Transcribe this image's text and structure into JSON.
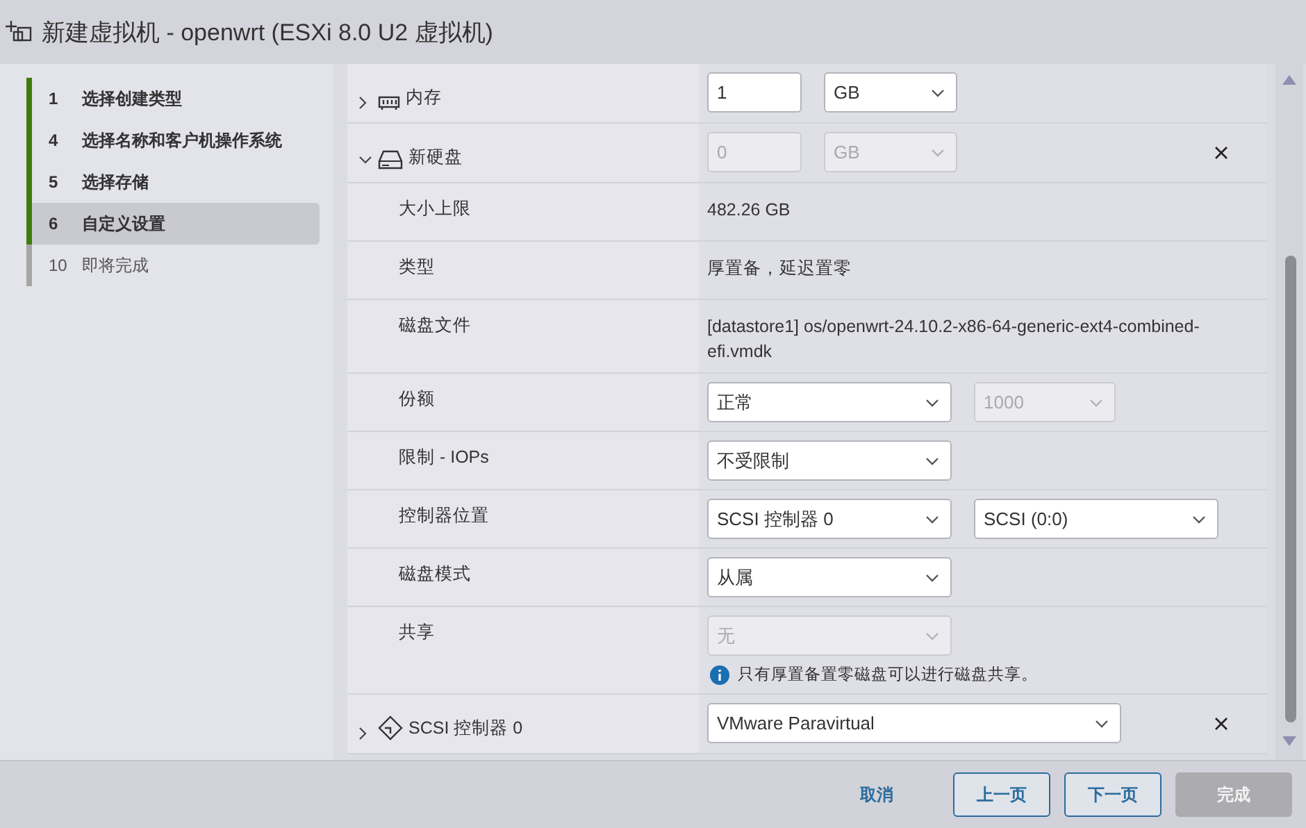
{
  "window": {
    "title": "新建虚拟机 - openwrt (ESXi 8.0 U2 虚拟机)"
  },
  "steps": [
    {
      "number": "1",
      "label": "选择创建类型",
      "completed": true,
      "selected": false
    },
    {
      "number": "4",
      "label": "选择名称和客户机操作系统",
      "completed": true,
      "selected": false
    },
    {
      "number": "5",
      "label": "选择存储",
      "completed": true,
      "selected": false
    },
    {
      "number": "6",
      "label": "自定义设置",
      "completed": true,
      "selected": true
    },
    {
      "number": "10",
      "label": "即将完成",
      "completed": false,
      "selected": false
    }
  ],
  "hardware": [
    {
      "kind": "device",
      "label": "内存",
      "expanded": false,
      "removable": false,
      "controls": [
        {
          "kind": "input",
          "value": "1",
          "disabled": false
        },
        {
          "kind": "select",
          "value": "GB",
          "disabled": false
        }
      ]
    },
    {
      "kind": "device",
      "label": "新硬盘",
      "expanded": true,
      "removable": true,
      "controls": [
        {
          "kind": "input",
          "value": "0",
          "disabled": true
        },
        {
          "kind": "select",
          "value": "GB",
          "disabled": true
        }
      ]
    },
    {
      "kind": "property",
      "label": "大小上限",
      "text": "482.26 GB"
    },
    {
      "kind": "property",
      "label": "类型",
      "text": "厚置备，延迟置零"
    },
    {
      "kind": "property",
      "label": "磁盘文件",
      "text": "[datastore1] os/openwrt-24.10.2-x86-64-generic-ext4-combined-efi.vmdk"
    },
    {
      "kind": "property",
      "label": "份额",
      "controls": [
        {
          "kind": "select",
          "value": "正常",
          "disabled": false
        },
        {
          "kind": "select",
          "value": "1000",
          "disabled": true
        }
      ]
    },
    {
      "kind": "property",
      "label": "限制 - IOPs",
      "controls": [
        {
          "kind": "select",
          "value": "不受限制",
          "disabled": false
        }
      ]
    },
    {
      "kind": "property",
      "label": "控制器位置",
      "controls": [
        {
          "kind": "select",
          "value": "SCSI 控制器 0",
          "disabled": false
        },
        {
          "kind": "select",
          "value": "SCSI (0:0)",
          "disabled": false
        }
      ]
    },
    {
      "kind": "property",
      "label": "磁盘模式",
      "controls": [
        {
          "kind": "select",
          "value": "从属",
          "disabled": false
        }
      ]
    },
    {
      "kind": "property",
      "label": "共享",
      "controls": [
        {
          "kind": "select",
          "value": "无",
          "disabled": true
        }
      ],
      "note": "只有厚置备置零磁盘可以进行磁盘共享。"
    },
    {
      "kind": "device",
      "label": "SCSI 控制器 0",
      "expanded": false,
      "removable": true,
      "controls": [
        {
          "kind": "select",
          "value": "VMware Paravirtual",
          "disabled": false
        }
      ]
    }
  ],
  "footer": {
    "buttons": [
      {
        "label": "取消",
        "kind": "link",
        "disabled": false
      },
      {
        "label": "上一页",
        "kind": "outline",
        "disabled": false
      },
      {
        "label": "下一页",
        "kind": "outline",
        "disabled": false
      },
      {
        "label": "完成",
        "kind": "primary",
        "disabled": true
      }
    ]
  }
}
